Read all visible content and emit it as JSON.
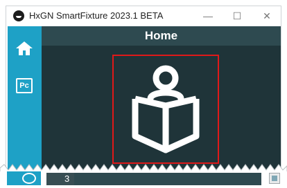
{
  "window": {
    "title": "HxGN SmartFixture 2023.1 BETA",
    "controls": {
      "minimize": "—",
      "maximize": "☐",
      "close": "✕"
    }
  },
  "sidebar": {
    "items": [
      {
        "icon": "home-icon"
      },
      {
        "icon": "pc-icon",
        "label": "Pc"
      }
    ],
    "footer_icon": "power-icon"
  },
  "main": {
    "title": "Home",
    "selected_item_icon": "reader-book-icon"
  },
  "status": {
    "page_value": "3"
  },
  "colors": {
    "sidebar": "#1ea1c6",
    "content_bg": "#1f3439",
    "header_bg": "#2e4a50",
    "selection_border": "#e01919"
  }
}
